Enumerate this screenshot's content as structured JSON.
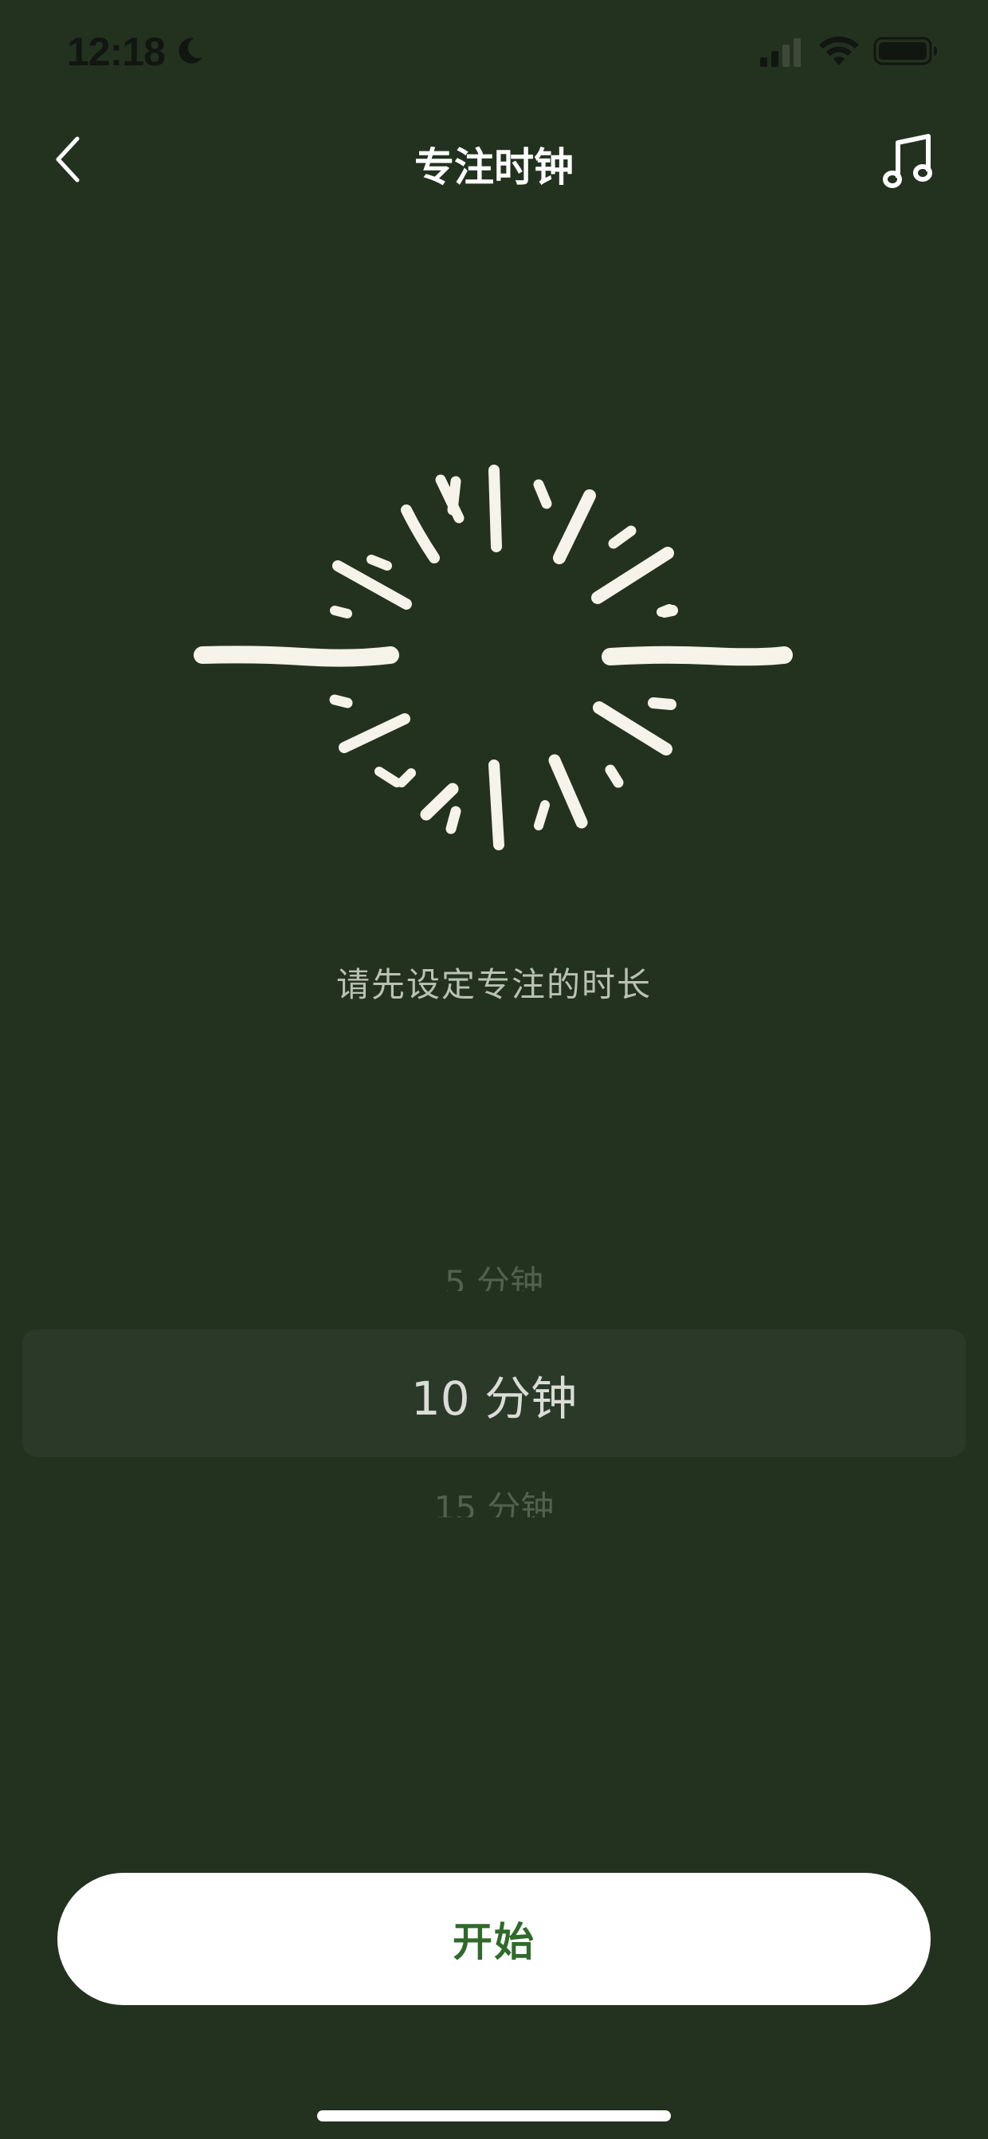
{
  "status_bar": {
    "time": "12:18",
    "moon_icon": "moon-icon",
    "signal_icon": "cellular-signal-icon",
    "wifi_icon": "wifi-icon",
    "battery_icon": "battery-icon"
  },
  "nav": {
    "back_icon": "chevron-left-icon",
    "title": "专注时钟",
    "music_icon": "music-note-icon"
  },
  "illustration": {
    "icon": "sunburst-icon"
  },
  "prompt": "请先设定专注的时长",
  "picker": {
    "options": [
      "5 分钟",
      "10 分钟",
      "15 分钟"
    ],
    "selected": "10 分钟"
  },
  "start_button": {
    "label": "开始"
  },
  "colors": {
    "background": "#23321f",
    "selection_bar": "#2b3a28",
    "button_bg": "#ffffff",
    "button_text": "#2f6a2a",
    "illustration": "#f5f3ea"
  }
}
